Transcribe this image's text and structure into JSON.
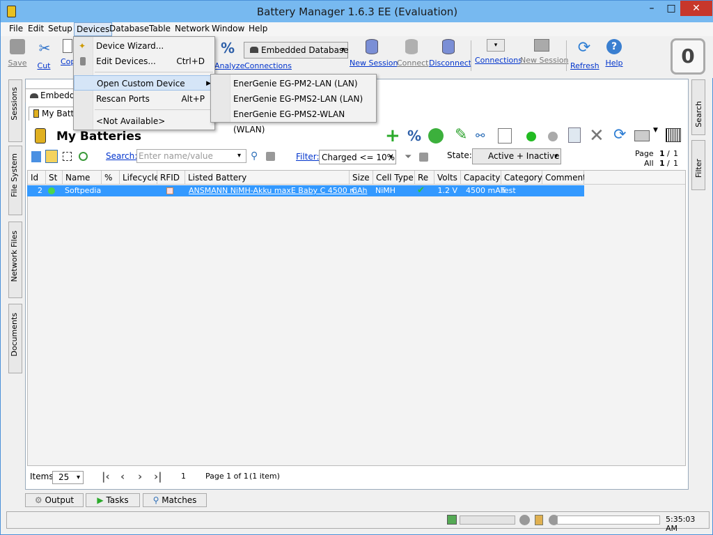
{
  "window": {
    "title": "Battery Manager 1.6.3 EE (Evaluation)",
    "minimize": "–",
    "maximize": "□",
    "close": "✕"
  },
  "menubar": [
    "File",
    "Edit",
    "Setup",
    "Devices",
    "Database",
    "Table",
    "Network",
    "Window",
    "Help"
  ],
  "toolbar": {
    "save": "Save",
    "cut": "Cut",
    "copy": "Cop",
    "analyze": "Analyze",
    "connections_left": "Connections",
    "db_combo": "Embedded Database",
    "new_session": "New Session",
    "connect": "Connect",
    "disconnect": "Disconnect",
    "connections": "Connections",
    "new_session2": "New Session",
    "refresh": "Refresh",
    "help": "Help",
    "counter": "0"
  },
  "devices_menu": {
    "items": [
      {
        "label": "Device Wizard...",
        "shortcut": ""
      },
      {
        "label": "Edit Devices...",
        "shortcut": "Ctrl+D"
      },
      {
        "label": "Open Custom Device",
        "shortcut": ""
      },
      {
        "label": "Rescan Ports",
        "shortcut": "Alt+P"
      },
      {
        "label": "<Not Available>",
        "shortcut": ""
      }
    ],
    "submenu": [
      "EnerGenie EG-PM2-LAN (LAN)",
      "EnerGenie EG-PMS2-LAN (LAN)",
      "EnerGenie EG-PMS2-WLAN (WLAN)"
    ]
  },
  "left_tabs": [
    "Sessions",
    "File System",
    "Network Files",
    "Documents"
  ],
  "right_tabs": [
    "Search",
    "Filter"
  ],
  "tabs": {
    "outer": "Embedde",
    "inner": "My Batte"
  },
  "doc": {
    "title": "My Batteries",
    "search_label": "Search:",
    "search_placeholder": "Enter name/value",
    "filter_label": "Filter:",
    "filter_value": "Charged <= 10%",
    "state_label": "State:",
    "state_value": "Active + Inactive",
    "page_label": "Page",
    "page_value": "1",
    "page_sep": "/",
    "page_total": "1",
    "all_label": "All",
    "all_value": "1",
    "all_total": "1"
  },
  "table": {
    "columns": [
      "Id",
      "St",
      "Name",
      "%",
      "Lifecycle",
      "RFID",
      "Listed Battery",
      "Size",
      "Cell Type",
      "Re",
      "Volts",
      "Capacity",
      "Category",
      "Comment"
    ],
    "rows": [
      {
        "id": "2",
        "name": "Softpedia",
        "listed_battery": "ANSMANN NiMH-Akku maxE Baby C 4500 mAh",
        "size": "C",
        "cell_type": "NiMH",
        "volts": "1.2 V",
        "capacity": "4500 mAh",
        "category": "Test",
        "comment": ""
      }
    ]
  },
  "footer": {
    "items_label": "Items",
    "items_value": "25",
    "page_num": "1",
    "page_info": "Page 1 of 1",
    "items_info": "(1 item)"
  },
  "bottom_buttons": [
    "Output",
    "Tasks",
    "Matches"
  ],
  "status": {
    "time": "5:35:03 AM"
  },
  "colors": {
    "accent": "#3399ff",
    "titlebar": "#77b9f0"
  }
}
